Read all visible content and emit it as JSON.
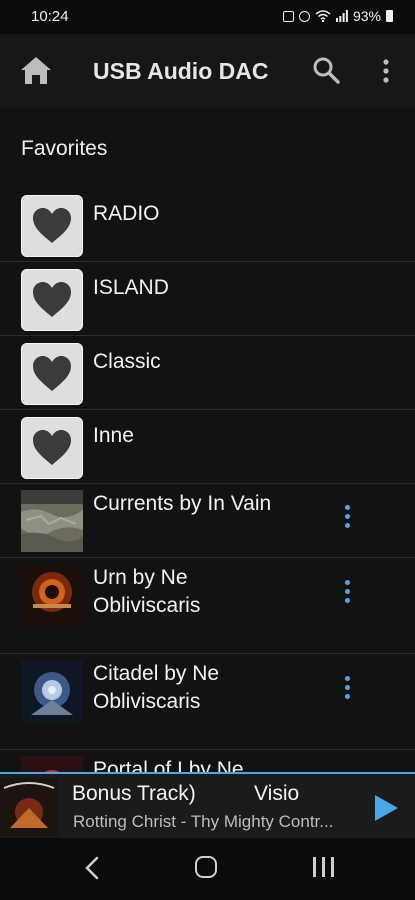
{
  "status_bar": {
    "time": "10:24",
    "battery": "93%",
    "icons": [
      "lock-icon",
      "alarm-icon",
      "wifi-icon",
      "signal-icon",
      "battery-icon"
    ]
  },
  "app_bar": {
    "title": "USB Audio DAC",
    "icons": [
      "home-icon",
      "search-icon",
      "more-vert-icon"
    ]
  },
  "section": {
    "title": "Favorites"
  },
  "favorites": [
    {
      "label": "RADIO",
      "icon": "heart-icon"
    },
    {
      "label": "ISLAND",
      "icon": "heart-icon"
    },
    {
      "label": "Classic",
      "icon": "heart-icon"
    },
    {
      "label": "Inne",
      "icon": "heart-icon"
    }
  ],
  "albums": [
    {
      "line1": "Currents by In Vain",
      "line2": "",
      "art": "album-art-currents"
    },
    {
      "line1": "Urn by Ne",
      "line2": "Obliviscaris",
      "art": "album-art-urn"
    },
    {
      "line1": "Citadel by Ne",
      "line2": "Obliviscaris",
      "art": "album-art-citadel"
    },
    {
      "line1": "Portal of I by Ne",
      "line2": "",
      "art": "album-art-portal"
    }
  ],
  "now_playing": {
    "title": "Bonus Track)          Visio",
    "subtitle": "Rotting Christ - Thy Mighty Contr...",
    "accent": "#4aa8e8"
  },
  "nav_bar": {
    "icons": [
      "back-icon",
      "home-nav-icon",
      "recents-icon"
    ]
  },
  "colors": {
    "background": "#121212",
    "accent": "#4aa8e8",
    "tile": "#dedede",
    "heart": "#3b3b3b"
  }
}
